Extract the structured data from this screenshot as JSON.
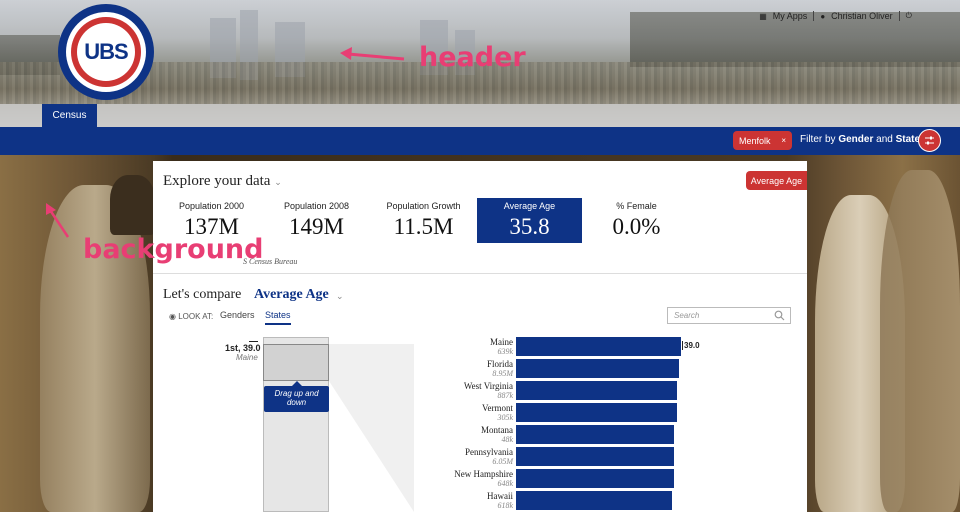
{
  "header": {
    "logo_text": "UBS",
    "nav": {
      "apps_label": "My Apps",
      "user_name": "Christian Oliver"
    },
    "tab_label": "Census"
  },
  "annotations": {
    "header": "header",
    "background": "background"
  },
  "filter_bar": {
    "chip_label": "Menfolk",
    "chip_close": "×",
    "label_prefix": "Filter by",
    "label_gender": "Gender",
    "label_and": "and",
    "label_state": "State"
  },
  "panel": {
    "explore_title": "Explore your data",
    "explore_caret": "⌄",
    "average_age_button": "Average Age",
    "stats": [
      {
        "label": "Population 2000",
        "value": "137M"
      },
      {
        "label": "Population 2008",
        "value": "149M"
      },
      {
        "label": "Population Growth",
        "value": "11.5M"
      },
      {
        "label": "Average Age",
        "value": "35.8",
        "active": true
      },
      {
        "label": "% Female",
        "value": "0.0%"
      }
    ],
    "source": "S Census Bureau",
    "compare_title": "Let's compare",
    "compare_metric": "Average Age",
    "compare_caret": "⌄",
    "look_at_label": "LOOK AT:",
    "tabs": [
      "Genders",
      "States"
    ],
    "active_tab": "States",
    "search_placeholder": "Search",
    "rank_label": "1st, 39.0",
    "rank_sub": "Maine",
    "drag_tooltip": "Drag up and down"
  },
  "chart_data": {
    "type": "bar",
    "categories": [
      "Maine",
      "Florida",
      "West Virginia",
      "Vermont",
      "Montana",
      "Pennsylvania",
      "New Hampshire",
      "Hawaii"
    ],
    "populations": [
      "639k",
      "8.95M",
      "887k",
      "305k",
      "48k",
      "6.05M",
      "648k",
      "618k"
    ],
    "values": [
      39.0,
      38.9,
      38.8,
      38.8,
      38.6,
      38.6,
      38.6,
      38.5
    ],
    "value_label_first": "39.0"
  },
  "colors": {
    "brand_blue": "#0e3386",
    "brand_red": "#cc3433",
    "annotation_pink": "#e83e74"
  }
}
